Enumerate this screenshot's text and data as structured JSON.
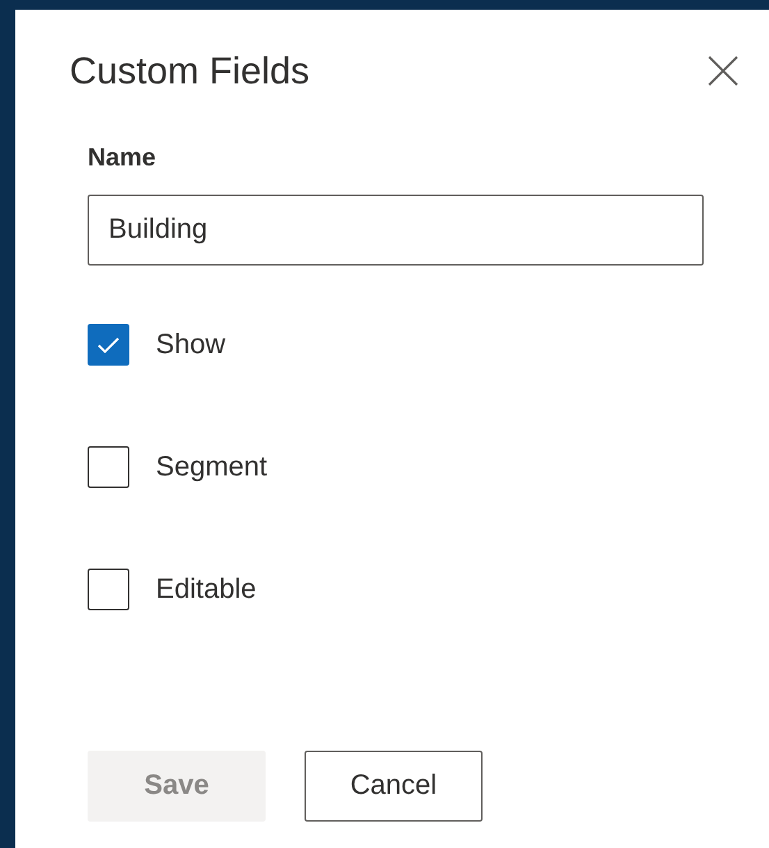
{
  "dialog": {
    "title": "Custom Fields"
  },
  "name_field": {
    "label": "Name",
    "value": "Building"
  },
  "options": [
    {
      "label": "Show",
      "checked": true
    },
    {
      "label": "Segment",
      "checked": false
    },
    {
      "label": "Editable",
      "checked": false
    }
  ],
  "buttons": [
    {
      "label": "Save",
      "disabled": true
    },
    {
      "label": "Cancel",
      "disabled": false
    }
  ]
}
